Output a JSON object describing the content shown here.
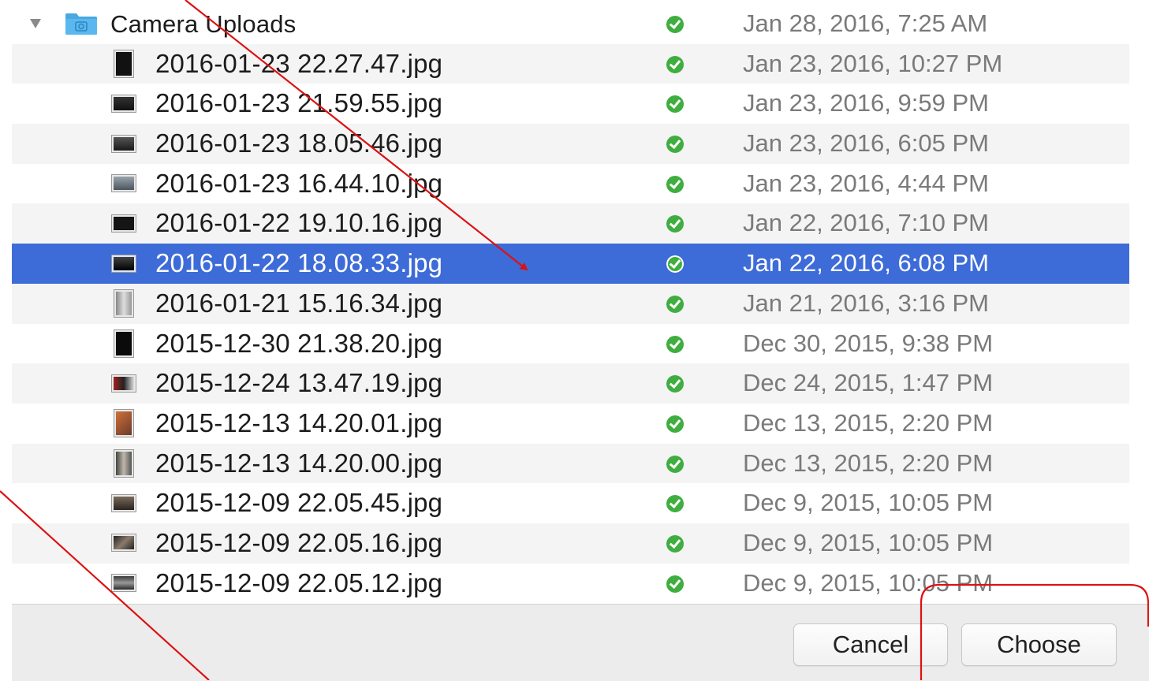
{
  "folder": {
    "name": "Camera Uploads",
    "modified": "Jan 28, 2016, 7:25 AM"
  },
  "files": [
    {
      "name": "2016-01-23 22.27.47.jpg",
      "modified": "Jan 23, 2016, 10:27 PM",
      "selected": false
    },
    {
      "name": "2016-01-23 21.59.55.jpg",
      "modified": "Jan 23, 2016, 9:59 PM",
      "selected": false
    },
    {
      "name": "2016-01-23 18.05.46.jpg",
      "modified": "Jan 23, 2016, 6:05 PM",
      "selected": false
    },
    {
      "name": "2016-01-23 16.44.10.jpg",
      "modified": "Jan 23, 2016, 4:44 PM",
      "selected": false
    },
    {
      "name": "2016-01-22 19.10.16.jpg",
      "modified": "Jan 22, 2016, 7:10 PM",
      "selected": false
    },
    {
      "name": "2016-01-22 18.08.33.jpg",
      "modified": "Jan 22, 2016, 6:08 PM",
      "selected": true
    },
    {
      "name": "2016-01-21 15.16.34.jpg",
      "modified": "Jan 21, 2016, 3:16 PM",
      "selected": false
    },
    {
      "name": "2015-12-30 21.38.20.jpg",
      "modified": "Dec 30, 2015, 9:38 PM",
      "selected": false
    },
    {
      "name": "2015-12-24 13.47.19.jpg",
      "modified": "Dec 24, 2015, 1:47 PM",
      "selected": false
    },
    {
      "name": "2015-12-13 14.20.01.jpg",
      "modified": "Dec 13, 2015, 2:20 PM",
      "selected": false
    },
    {
      "name": "2015-12-13 14.20.00.jpg",
      "modified": "Dec 13, 2015, 2:20 PM",
      "selected": false
    },
    {
      "name": "2015-12-09 22.05.45.jpg",
      "modified": "Dec 9, 2015, 10:05 PM",
      "selected": false
    },
    {
      "name": "2015-12-09 22.05.16.jpg",
      "modified": "Dec 9, 2015, 10:05 PM",
      "selected": false
    },
    {
      "name": "2015-12-09 22.05.12.jpg",
      "modified": "Dec 9, 2015, 10:05 PM",
      "selected": false
    }
  ],
  "buttons": {
    "cancel": "Cancel",
    "choose": "Choose"
  },
  "colors": {
    "selection": "#3d6bd8",
    "sync_ok": "#3fae3f",
    "annotation": "#dd1111",
    "folder": "#4aa8e0"
  },
  "icons": {
    "folder": "camera-folder-icon",
    "sync": "sync-check-icon",
    "disclosure": "disclosure-triangle-icon",
    "file": "image-thumbnail-icon"
  }
}
